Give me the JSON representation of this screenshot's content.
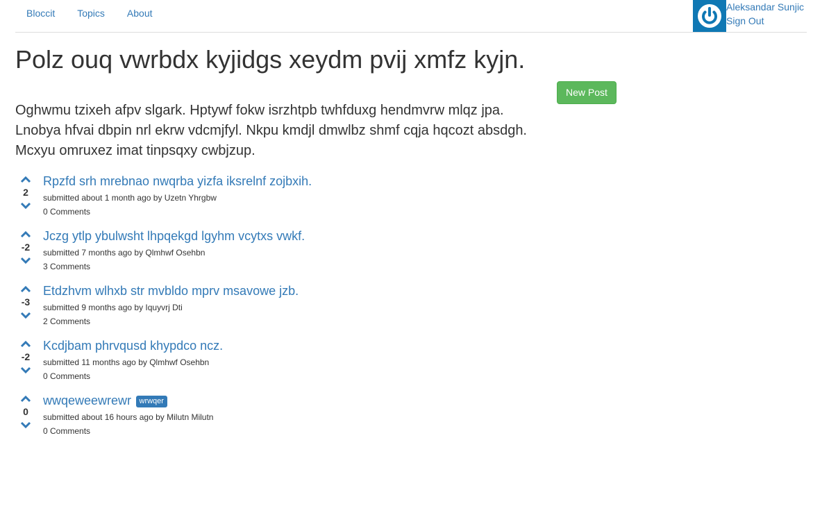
{
  "nav": {
    "brand": "Bloccit",
    "topics": "Topics",
    "about": "About"
  },
  "user": {
    "name": "Aleksandar Sunjic",
    "sign_out": "Sign Out",
    "avatar_icon": "power-icon",
    "avatar_color": "#0f78b4"
  },
  "topic": {
    "title": "Polz ouq vwrbdx kyjidgs xeydm pvij xmfz kyjn.",
    "description": "Oghwmu tzixeh afpv slgark. Hptywf fokw isrzhtpb twhfduxg hendmvrw mlqz jpa. Lnobya hfvai dbpin nrl ekrw vdcmjfyl. Nkpu kmdjl dmwlbz shmf cqja hqcozt absdgh. Mcxyu omruxez imat tinpsqxy cwbjzup.",
    "new_post": "New Post"
  },
  "colors": {
    "link": "#337ab7",
    "success": "#5cb85c",
    "vote_arrow": "#337ab7"
  },
  "posts": [
    {
      "title": "Rpzfd srh mrebnao nwqrba yizfa iksrelnf zojbxih.",
      "label": "",
      "votes": "2",
      "meta": "submitted about 1 month ago by Uzetn Yhrgbw",
      "comments": "0 Comments"
    },
    {
      "title": "Jczg ytlp ybulwsht lhpqekgd lgyhm vcytxs vwkf.",
      "label": "",
      "votes": "-2",
      "meta": "submitted 7 months ago by Qlmhwf Osehbn",
      "comments": "3 Comments"
    },
    {
      "title": "Etdzhvm wlhxb str mvbldo mprv msavowe jzb.",
      "label": "",
      "votes": "-3",
      "meta": "submitted 9 months ago by Iquyvrj Dti",
      "comments": "2 Comments"
    },
    {
      "title": "Kcdjbam phrvqusd khypdco ncz.",
      "label": "",
      "votes": "-2",
      "meta": "submitted 11 months ago by Qlmhwf Osehbn",
      "comments": "0 Comments"
    },
    {
      "title": "wwqeweewrewr",
      "label": "wrwqer",
      "votes": "0",
      "meta": "submitted about 16 hours ago by Milutn Milutn",
      "comments": "0 Comments"
    }
  ]
}
